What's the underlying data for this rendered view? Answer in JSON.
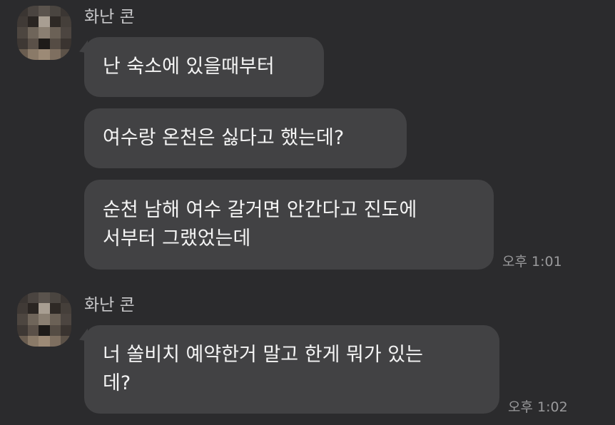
{
  "messages_groups": [
    {
      "sender": "화난 콘",
      "messages": [
        {
          "text": "난 숙소에 있을때부터"
        },
        {
          "text": "여수랑 온천은 싫다고 했는데?"
        },
        {
          "text": "순천 남해 여수 갈거면 안간다고 진도에\n서부터 그랬었는데"
        }
      ],
      "time": "오후 1:01"
    },
    {
      "sender": "화난 콘",
      "messages": [
        {
          "text": "너 쏠비치 예약한거 말고 한게 뭐가 있는\n데?"
        }
      ],
      "time": "오후 1:02"
    }
  ],
  "colors": {
    "background": "#2b2b2d",
    "bubble": "#424244",
    "text": "#f4f4f4",
    "sender": "#c9c9cb",
    "time": "#9a9a9c"
  }
}
